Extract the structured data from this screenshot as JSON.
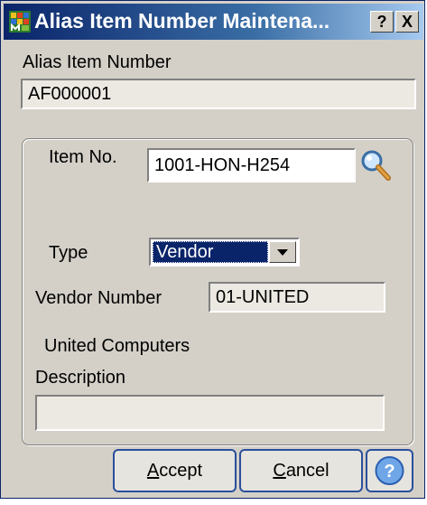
{
  "window": {
    "title": "Alias Item Number Maintena...",
    "help_btn": "?",
    "close_btn": "X"
  },
  "alias": {
    "label": "Alias Item Number",
    "value": "AF000001"
  },
  "item": {
    "label": "Item No.",
    "value": "1001-HON-H254"
  },
  "type": {
    "label": "Type",
    "value": "Vendor"
  },
  "vendor": {
    "label": "Vendor Number",
    "value": "01-UNITED",
    "name": "United Computers"
  },
  "description": {
    "label": "Description",
    "value": ""
  },
  "buttons": {
    "accept_prefix": "",
    "accept_u": "A",
    "accept_rest": "ccept",
    "cancel_prefix": "",
    "cancel_u": "C",
    "cancel_rest": "ancel"
  },
  "icons": {
    "app": "app-grid-icon",
    "lookup": "magnifier-icon",
    "dropdown": "dropdown-arrow-icon",
    "help": "help-icon"
  }
}
